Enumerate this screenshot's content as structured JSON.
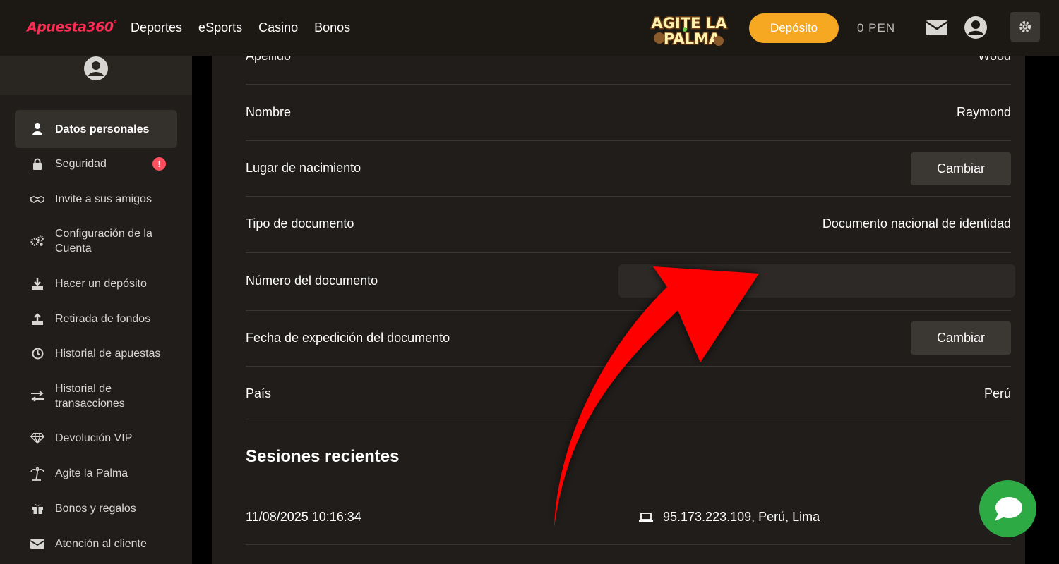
{
  "header": {
    "logo": "Apuesta360",
    "logo_mark": "°",
    "nav": [
      "Deportes",
      "eSports",
      "Casino",
      "Bonos"
    ],
    "promo": "AGITE LA PALMA",
    "deposit": "Depósito",
    "balance": "0  PEN"
  },
  "sidebar": {
    "items": [
      {
        "label": "Datos personales",
        "icon": "user-icon"
      },
      {
        "label": "Seguridad",
        "icon": "lock-icon",
        "badge": "!"
      },
      {
        "label": "Invite a sus amigos",
        "icon": "handshake-icon"
      },
      {
        "label": "Configuración de la Cuenta",
        "icon": "gears-icon"
      },
      {
        "label": "Hacer un depósito",
        "icon": "download-icon"
      },
      {
        "label": "Retirada de fondos",
        "icon": "upload-icon"
      },
      {
        "label": "Historial de apuestas",
        "icon": "clock-icon"
      },
      {
        "label": "Historial de transacciones",
        "icon": "arrows-icon"
      },
      {
        "label": "Devolución VIP",
        "icon": "diamond-icon"
      },
      {
        "label": "Agite la Palma",
        "icon": "palm-icon"
      },
      {
        "label": "Bonos y regalos",
        "icon": "gift-icon"
      },
      {
        "label": "Atención al cliente",
        "icon": "mail-icon"
      }
    ]
  },
  "main": {
    "rows": [
      {
        "label": "Apellido",
        "value": "Wood"
      },
      {
        "label": "Nombre",
        "value": "Raymond"
      },
      {
        "label": "Lugar de nacimiento",
        "button": "Cambiar"
      },
      {
        "label": "Tipo de documento",
        "value": "Documento nacional de identidad"
      },
      {
        "label": "Número del documento",
        "input_value": ""
      },
      {
        "label": "Fecha de expedición del documento",
        "button": "Cambiar"
      },
      {
        "label": "País",
        "value": "Perú"
      }
    ],
    "sessions_title": "Sesiones recientes",
    "sessions": [
      {
        "date": "11/08/2025 10:16:34",
        "location": "95.173.223.109, Perú, Lima"
      }
    ]
  },
  "colors": {
    "accent": "#f7a823",
    "brand": "#ff2d55",
    "arrow": "#ff0000",
    "chat": "#2eaa45"
  }
}
